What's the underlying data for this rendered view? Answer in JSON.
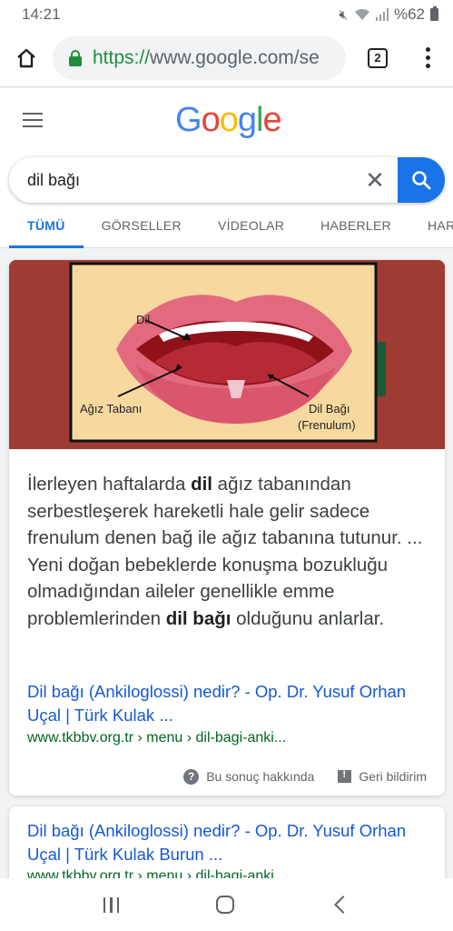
{
  "status_bar": {
    "time": "14:21",
    "battery": "%62",
    "icons": [
      "mute-icon",
      "alarm-icon",
      "wifi-icon",
      "signal-icon",
      "battery-icon"
    ]
  },
  "browser": {
    "url_scheme": "https://",
    "url_host": "www.google.com",
    "url_rest": "/se",
    "tab_count": "2"
  },
  "google": {
    "logo_letters": [
      {
        "char": "G",
        "color": "#4285F4"
      },
      {
        "char": "o",
        "color": "#EA4335"
      },
      {
        "char": "o",
        "color": "#FBBC05"
      },
      {
        "char": "g",
        "color": "#4285F4"
      },
      {
        "char": "l",
        "color": "#34A853"
      },
      {
        "char": "e",
        "color": "#EA4335"
      }
    ],
    "query": "dil bağı",
    "nav_tabs": [
      "TÜMÜ",
      "GÖRSELLER",
      "VİDEOLAR",
      "HABERLER",
      "HARİTALAR"
    ]
  },
  "featured": {
    "image_labels": {
      "tongue": "Dil",
      "floor": "Ağız Tabanı",
      "frenulum_line1": "Dil Bağı",
      "frenulum_line2": "(Frenulum)"
    },
    "snippet": {
      "p1": "İlerleyen haftalarda ",
      "b1": "dil",
      "p2": " ağız tabanından serbestleşerek hareketli hale gelir sadece frenulum denen bağ ile ağız tabanına tutunur. ... Yeni doğan bebeklerde konuşma bozukluğu olmadığından aileler genellikle emme problemlerinden ",
      "b2": "dil bağı",
      "p3": " olduğunu anlarlar."
    },
    "link_title": "Dil bağı (Ankiloglossi) nedir? - Op. Dr. Yusuf Orhan Uçal | Türk Kulak ...",
    "link_url": "www.tkbbv.org.tr › menu › dil-bagi-anki...",
    "about_label": "Bu sonuç hakkında",
    "feedback_label": "Geri bildirim"
  },
  "result2": {
    "title": "Dil bağı (Ankiloglossi) nedir? - Op. Dr. Yusuf Orhan Uçal | Türk Kulak Burun ...",
    "url": "www.tkbbv.org.tr › menu › dil-bagi-anki..."
  },
  "colors": {
    "link": "#1558d6",
    "url_green": "#006621",
    "accent": "#1a73e8"
  }
}
